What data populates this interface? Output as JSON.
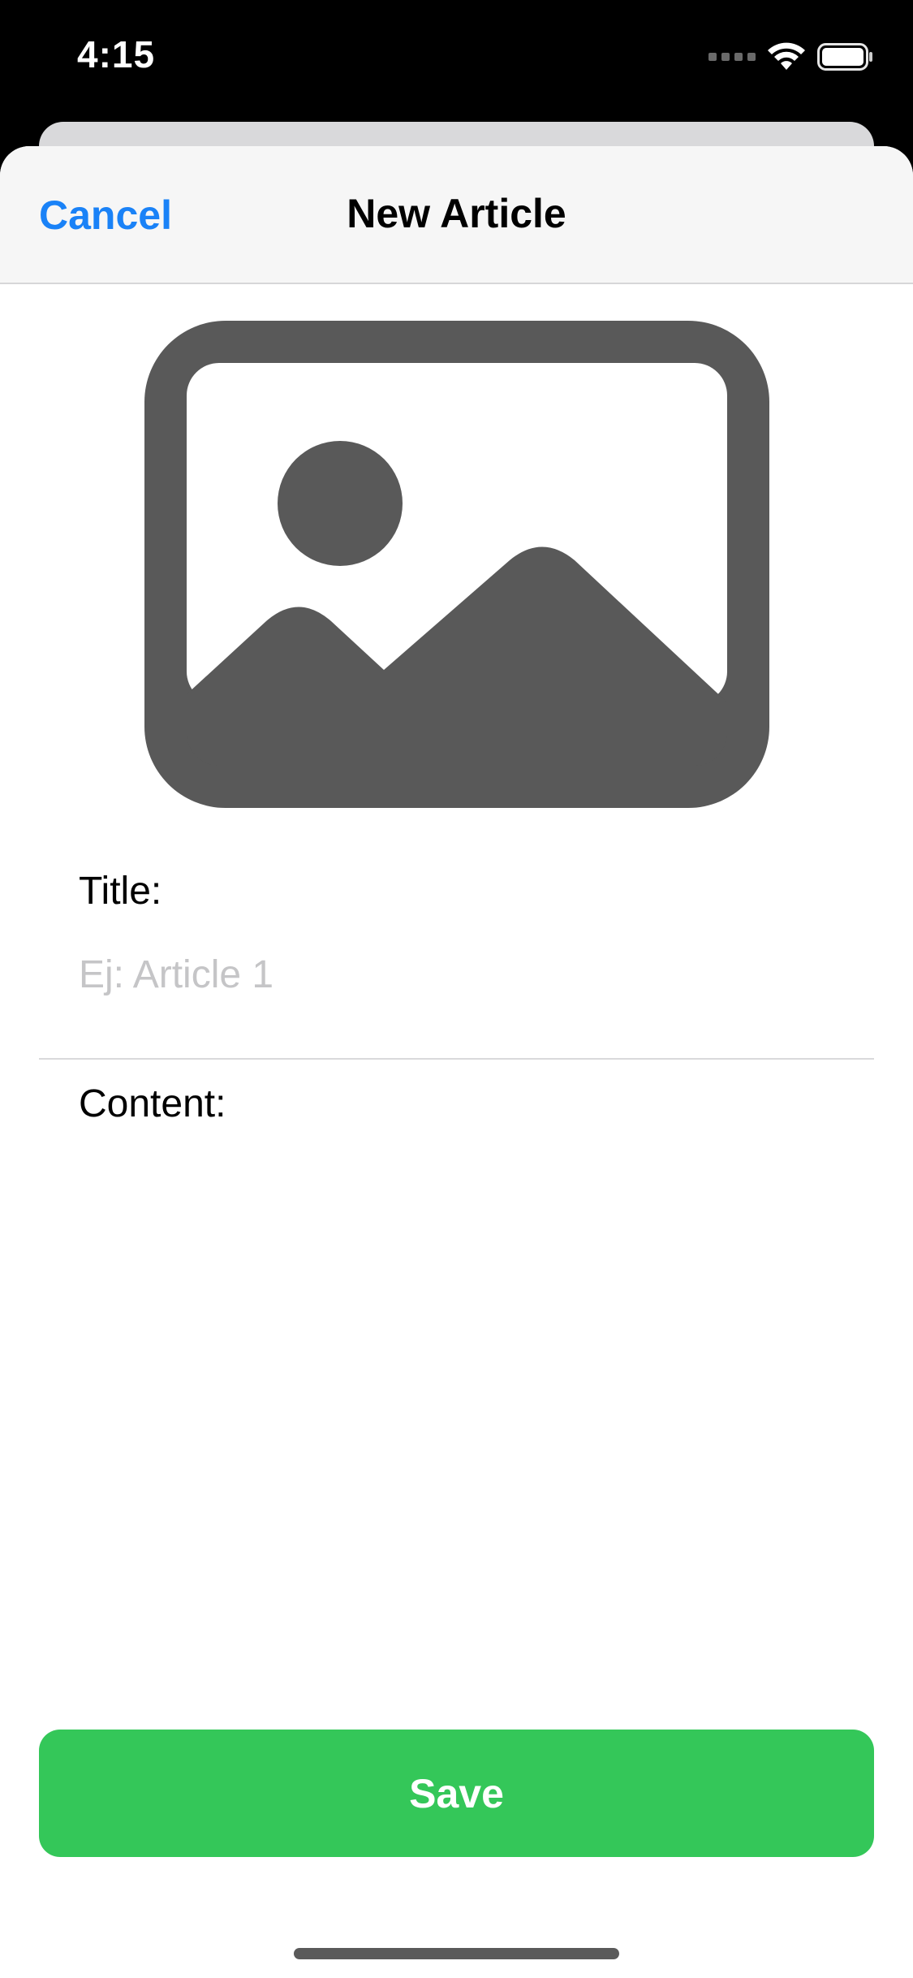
{
  "status_bar": {
    "time": "4:15",
    "icons": [
      "signal-icon",
      "wifi-icon",
      "battery-icon"
    ]
  },
  "nav": {
    "cancel_label": "Cancel",
    "title": "New Article"
  },
  "image_placeholder": {
    "icon": "photo-icon"
  },
  "form": {
    "title_label": "Title:",
    "title_value": "",
    "title_placeholder": "Ej: Article 1",
    "content_label": "Content:",
    "content_value": ""
  },
  "actions": {
    "save_label": "Save"
  },
  "colors": {
    "accent": "#1a82f7",
    "save_button": "#34c759",
    "icon_gray": "#595959",
    "placeholder": "#c5c5c7"
  }
}
